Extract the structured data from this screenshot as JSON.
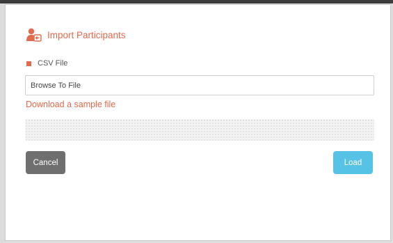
{
  "dialog": {
    "title": "Import Participants",
    "title_icon": "user-import-icon",
    "section_label": "CSV File",
    "section_icon": "square-icon",
    "file_input_value": "Browse To File",
    "download_link": "Download a sample file",
    "cancel_label": "Cancel",
    "load_label": "Load"
  },
  "colors": {
    "accent": "#e36a4c",
    "cancel_bg": "#6f6f6f",
    "load_bg": "#56c2e6"
  }
}
